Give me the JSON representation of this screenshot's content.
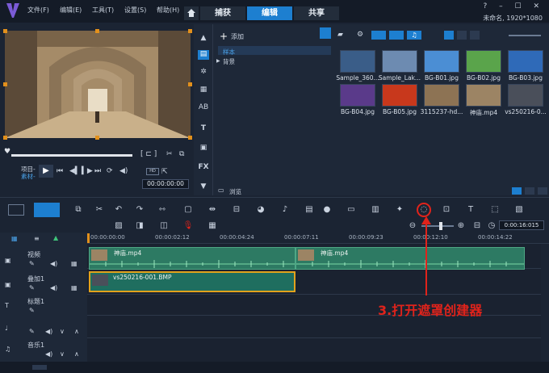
{
  "menu": {
    "file": "文件(F)",
    "edit": "编辑(E)",
    "tools": "工具(T)",
    "settings": "设置(S)",
    "help": "帮助(H)"
  },
  "tabs": {
    "capture": "捕获",
    "edit": "编辑",
    "share": "共享"
  },
  "project_info": "未命名, 1920*1080",
  "preview": {
    "mode_project": "项目-",
    "mode_clip": "素材-",
    "timecode": "00:00:00:00"
  },
  "library": {
    "add_label": "添加",
    "tree": [
      "样本",
      "背景"
    ],
    "browse_label": "浏览"
  },
  "media_items": [
    {
      "label": "Sample_360...",
      "color": "#3a5d88"
    },
    {
      "label": "Sample_Lak...",
      "color": "#6d8bb1"
    },
    {
      "label": "BG-B01.jpg",
      "color": "#4b8ed4"
    },
    {
      "label": "BG-B02.jpg",
      "color": "#5aa44b"
    },
    {
      "label": "BG-B03.jpg",
      "color": "#2f6ab8"
    },
    {
      "label": "BG-B04.jpg",
      "color": "#5a3a8a"
    },
    {
      "label": "BG-B05.jpg",
      "color": "#c8381c"
    },
    {
      "label": "3115237-hd...",
      "color": "#8d7354"
    },
    {
      "label": "神庙.mp4",
      "color": "#9c8464"
    },
    {
      "label": "vs250216-0...",
      "color": "#4a4f5a"
    }
  ],
  "timeline": {
    "timecode": "0:00:16:015",
    "ruler": [
      "00:00:00:00",
      "00:00:02:12",
      "00:00:04:24",
      "00:00:07:11",
      "00:00:09:23",
      "00:00:12:10",
      "00:00:14:22"
    ],
    "tracks": {
      "video": "视频",
      "overlay": "叠加1",
      "title": "标题1",
      "music": "音乐1"
    },
    "clip_video_1": "神庙.mp4",
    "clip_video_2": "神庙.mp4",
    "clip_overlay": "vs250216-001.BMP"
  },
  "annotation": "3.打开遮罩创建器",
  "colors": {
    "accent": "#1d7fd0",
    "clip": "#2d7a63",
    "annotation": "#e0231b"
  }
}
